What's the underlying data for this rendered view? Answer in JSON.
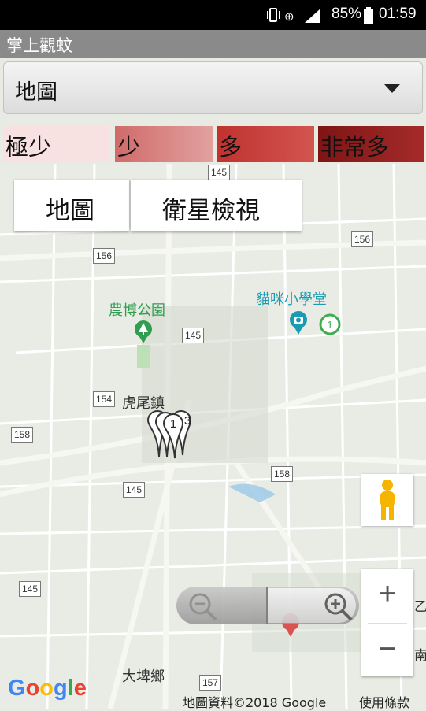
{
  "status_bar": {
    "battery": "85%",
    "time": "01:59"
  },
  "app": {
    "title": "掌上觀蚊"
  },
  "spinner": {
    "selected": "地圖"
  },
  "legend": [
    {
      "label": "極少",
      "color": "#f8e1e1"
    },
    {
      "label": "少",
      "color": "#d98a88"
    },
    {
      "label": "多",
      "color": "#c9413d"
    },
    {
      "label": "非常多",
      "color": "#962221"
    }
  ],
  "map_type": {
    "map_label": "地圖",
    "satellite_label": "衛星檢視"
  },
  "map": {
    "poi": {
      "park": "農博公園",
      "school": "貓咪小學堂"
    },
    "places": {
      "huwei": "虎尾鎮",
      "dapi": "大埤鄉"
    },
    "road_shields": [
      "145",
      "156",
      "145",
      "156",
      "154",
      "158",
      "158",
      "145",
      "145",
      "157"
    ],
    "markers": [
      "1",
      "3"
    ],
    "poi_badge": "1",
    "edge_labels": [
      "乙",
      "南"
    ],
    "zoom_in": "+",
    "zoom_out": "−"
  },
  "footer": {
    "logo": "Google",
    "attribution": "地圖資料©2018 Google",
    "terms": "使用條款"
  },
  "colors": {
    "park": "#2e9e4f",
    "school": "#1a9bb3",
    "title_bar": "#8a8a8a"
  }
}
